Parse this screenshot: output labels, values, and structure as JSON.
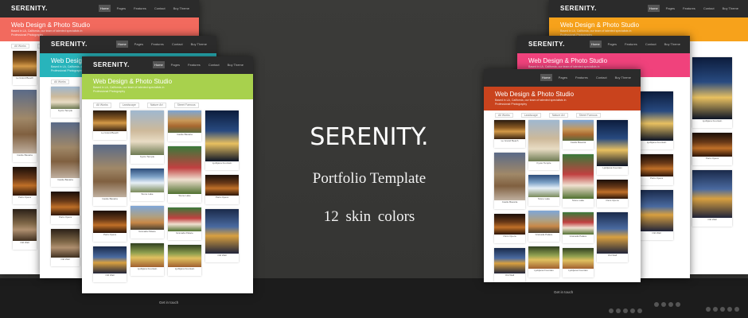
{
  "headline": {
    "brand": "SERENITY.",
    "tagline": "Portfolio Template",
    "skins": "12 skin colors"
  },
  "template": {
    "logo": "SERENITY.",
    "nav": [
      "Home",
      "Pages",
      "Features",
      "Contact",
      "Buy Theme"
    ],
    "banner_title": "Web Design & Photo Studio",
    "banner_sub": "Based in LA, California, our team of talented specialists in Professional Photography",
    "filters": [
      "All Works",
      "Landscape",
      "Nature Art",
      "Street Famous"
    ],
    "captions": [
      "Le Grand Beach",
      "Kyoto Temple",
      "Castle Bavaria",
      "Stone Lake",
      "Paris Opera",
      "Granada Palace",
      "Old Wall",
      "Ljubljana Fountain"
    ],
    "footer_title": "Get in touch"
  },
  "skin_colors": {
    "coral": "#f26a5e",
    "teal": "#28b4bb",
    "lime": "#a8d14d",
    "orange": "#f7a21b",
    "pink": "#f0427c",
    "rust": "#c9431d"
  }
}
